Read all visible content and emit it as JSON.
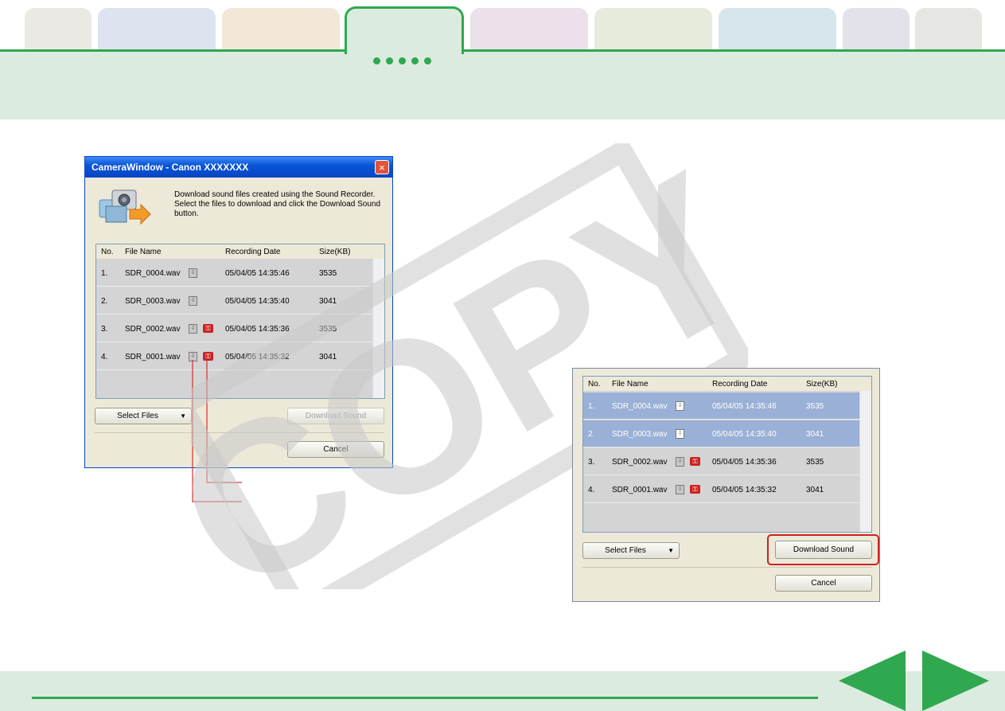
{
  "header": {
    "tabs": [
      {
        "color": "#ebe9e4"
      },
      {
        "color": "#dde3ef"
      },
      {
        "color": "#f3e7da"
      },
      {
        "color": "#dcebe0"
      },
      {
        "color": "#ece0ea"
      },
      {
        "color": "#e7ebdb"
      },
      {
        "color": "#d6e6ec"
      },
      {
        "color": "#e3e1ea"
      },
      {
        "color": "#e6e6e2"
      }
    ],
    "accent": "#2fa84f"
  },
  "watermark": "COPY",
  "dialog1": {
    "title": "CameraWindow - Canon XXXXXXX",
    "close_glyph": "×",
    "instructions": "Download sound files created using the Sound Recorder. Select the files to download and click the Download Sound button.",
    "columns": [
      "No.",
      "File Name",
      "Recording Date",
      "Size(KB)"
    ],
    "rows": [
      {
        "no": "1.",
        "file": "SDR_0004.wav",
        "date": "05/04/05 14:35:46",
        "size": "3535",
        "protected": false
      },
      {
        "no": "2.",
        "file": "SDR_0003.wav",
        "date": "05/04/05 14:35:40",
        "size": "3041",
        "protected": false
      },
      {
        "no": "3.",
        "file": "SDR_0002.wav",
        "date": "05/04/05 14:35:36",
        "size": "3535",
        "protected": true
      },
      {
        "no": "4.",
        "file": "SDR_0001.wav",
        "date": "05/04/05 14:35:32",
        "size": "3041",
        "protected": true
      }
    ],
    "select_files": "Select Files",
    "download_sound": "Download Sound",
    "cancel": "Cancel"
  },
  "dialog2": {
    "columns": [
      "No.",
      "File Name",
      "Recording Date",
      "Size(KB)"
    ],
    "rows": [
      {
        "no": "1.",
        "file": "SDR_0004.wav",
        "date": "05/04/05 14:35:46",
        "size": "3535",
        "protected": false,
        "selected": true
      },
      {
        "no": "2.",
        "file": "SDR_0003.wav",
        "date": "05/04/05 14:35:40",
        "size": "3041",
        "protected": false,
        "selected": true
      },
      {
        "no": "3.",
        "file": "SDR_0002.wav",
        "date": "05/04/05 14:35:36",
        "size": "3535",
        "protected": true,
        "selected": false
      },
      {
        "no": "4.",
        "file": "SDR_0001.wav",
        "date": "05/04/05 14:35:32",
        "size": "3041",
        "protected": true,
        "selected": false
      }
    ],
    "select_files": "Select Files",
    "download_sound": "Download Sound",
    "cancel": "Cancel",
    "highlight_color": "#cc2222"
  },
  "nav": {
    "prev_icon": "previous-page-arrow",
    "next_icon": "next-page-arrow",
    "color": "#2fa84f"
  }
}
